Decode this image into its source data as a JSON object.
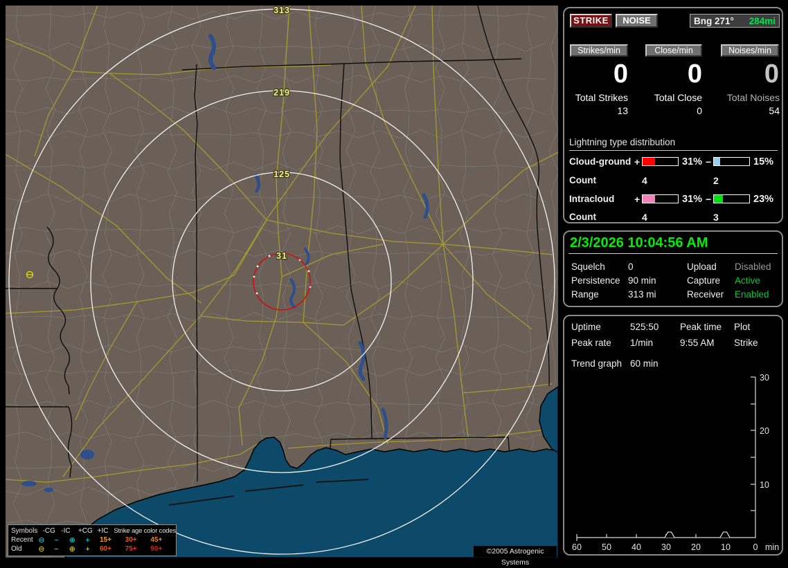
{
  "colors": {
    "accent_green": "#00e050",
    "status_active_green": "#00cc33",
    "status_disabled_gray": "#9a9a9a",
    "strike_button_red": "#771212",
    "cloud_ground_plus_bar": "#ff0000",
    "cloud_ground_minus_bar": "#9ccdf0",
    "intracloud_plus_bar": "#ee82b8",
    "intracloud_minus_bar": "#00dd11",
    "recent_symbol_cyan": "#00dce8",
    "old_symbol_yellow": "#f0e400",
    "range_ring_white": "#f2f2f2",
    "close_ring_red": "#cc1111",
    "map_land": "#6b6057",
    "map_water": "#0d4a69",
    "range_label_yellow": "#f4ef82"
  },
  "map": {
    "range_labels": [
      "313",
      "219",
      "125",
      "31"
    ],
    "copyright": "©2005 Astrogenic Systems",
    "legend": {
      "symbols_header": "Symbols",
      "type_headers": [
        "-CG",
        "-IC",
        "+CG",
        "+IC"
      ],
      "age_header": "Strike age color codes",
      "rows": [
        {
          "label": "Recent",
          "symbols": [
            "⊖",
            "−",
            "⊕",
            "+"
          ],
          "ages": [
            "15+",
            "30+",
            "45+"
          ]
        },
        {
          "label": "Old",
          "symbols": [
            "⊖",
            "−",
            "⊕",
            "+"
          ],
          "ages": [
            "60+",
            "75+",
            "90+"
          ]
        }
      ]
    }
  },
  "panel_counters": {
    "strike_button": "STRIKE",
    "noise_button": "NOISE",
    "bearing_label": "Bng 271°",
    "bearing_value": "284mi",
    "columns": [
      {
        "header": "Strikes/min",
        "rate": "0",
        "total_label": "Total Strikes",
        "total_value": "13"
      },
      {
        "header": "Close/min",
        "rate": "0",
        "total_label": "Total Close",
        "total_value": "0"
      },
      {
        "header": "Noises/min",
        "rate": "0",
        "total_label": "Total Noises",
        "total_value": "54"
      }
    ],
    "distribution": {
      "title": "Lightning type distribution",
      "rows": [
        {
          "label": "Cloud-ground",
          "plus_sign": "+",
          "plus_pct": "31%",
          "minus_sign": "−",
          "minus_pct": "15%",
          "count_label": "Count",
          "plus_count": "4",
          "minus_count": "2"
        },
        {
          "label": "Intracloud",
          "plus_sign": "+",
          "plus_pct": "31%",
          "minus_sign": "−",
          "minus_pct": "23%",
          "count_label": "Count",
          "plus_count": "4",
          "minus_count": "3"
        }
      ]
    }
  },
  "panel_status": {
    "datetime": "2/3/2026 10:04:56 AM",
    "rows": [
      {
        "label": "Squelch",
        "value": "0",
        "label2": "Upload",
        "value2": "Disabled"
      },
      {
        "label": "Persistence",
        "value": "90 min",
        "label2": "Capture",
        "value2": "Active"
      },
      {
        "label": "Range",
        "value": "313 mi",
        "label2": "Receiver",
        "value2": "Enabled"
      }
    ]
  },
  "panel_trend": {
    "rows": [
      {
        "label": "Uptime",
        "value": "525:50",
        "label2": "Peak time",
        "value2": "Plot"
      },
      {
        "label": "Peak rate",
        "value": "1/min",
        "label2": "9:55 AM",
        "value2": "Strike"
      }
    ],
    "trend_label": "Trend graph",
    "trend_value": "60 min"
  },
  "chart_data": {
    "type": "line",
    "title": "Strike rate trend graph (last 60 min)",
    "xlabel": "min",
    "x_unit": "min",
    "xlim": [
      60,
      0
    ],
    "ylim": [
      0,
      30
    ],
    "x_tick_labels": [
      "60",
      "50",
      "40",
      "30",
      "20",
      "10",
      "0"
    ],
    "y_tick_labels": [
      "30",
      "20",
      "10"
    ],
    "series": [
      {
        "name": "Strikes/min",
        "points": [
          {
            "minutes_ago": 29,
            "rate": 1
          },
          {
            "minutes_ago": 10,
            "rate": 1
          }
        ],
        "baseline_rate": 0
      }
    ]
  }
}
